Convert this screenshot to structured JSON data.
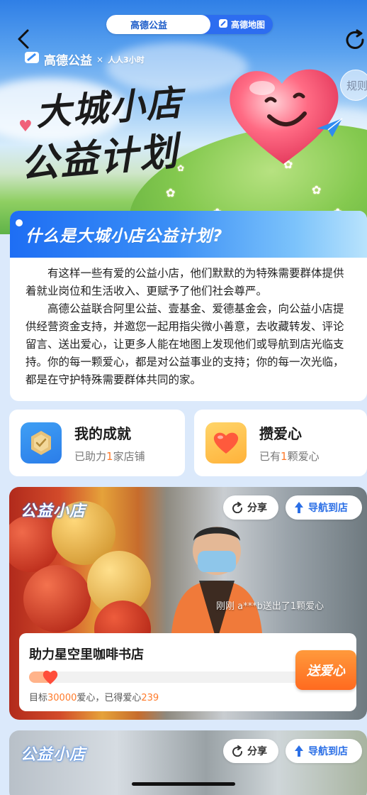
{
  "search_bar": {
    "gongyi_label": "高德公益",
    "map_label": "高德地图"
  },
  "hero": {
    "brand_gaode": "高德公益",
    "brand_x": "×",
    "brand_partner": "人人3小时",
    "title_line1": "大城小店",
    "title_line2": "公益计划",
    "rules_label": "规则"
  },
  "intro": {
    "heading": "什么是大城小店公益计划?",
    "paragraph1": "有这样一些有爱的公益小店，他们默默的为特殊需要群体提供着就业岗位和生活收入、更赋予了他们社会尊严。",
    "paragraph2": "高德公益联合阿里公益、壹基金、爱德基金会，向公益小店提供经营资金支持，并邀您一起用指尖微小善意，去收藏转发、评论留言、送出爱心，让更多人能在地图上发现他们或导航到店光临支持。你的每一颗爱心，都是对公益事业的支持；你的每一次光临，都是在守护特殊需要群体共同的家。"
  },
  "stats": {
    "achievement": {
      "title": "我的成就",
      "sub_prefix": "已助力",
      "count": "1",
      "sub_suffix": "家店铺"
    },
    "collect": {
      "title": "攒爱心",
      "sub_prefix": "已有",
      "count": "1",
      "sub_suffix": "颗爱心"
    }
  },
  "shops": [
    {
      "badge": "公益小店",
      "share_label": "分享",
      "nav_label": "导航到店",
      "ticker": "刚刚 a***b送出了1颗爱心",
      "name": "助力星空里咖啡书店",
      "goal_prefix": "目标",
      "goal": "30000",
      "goal_mid": "爱心，已得爱心",
      "received": "239",
      "progress_fraction": 0.008,
      "send_label": "送爱心"
    },
    {
      "badge": "公益小店",
      "share_label": "分享",
      "nav_label": "导航到店"
    }
  ],
  "colors": {
    "brand_blue": "#2d6df0",
    "accent_orange": "#ff7a2a"
  }
}
